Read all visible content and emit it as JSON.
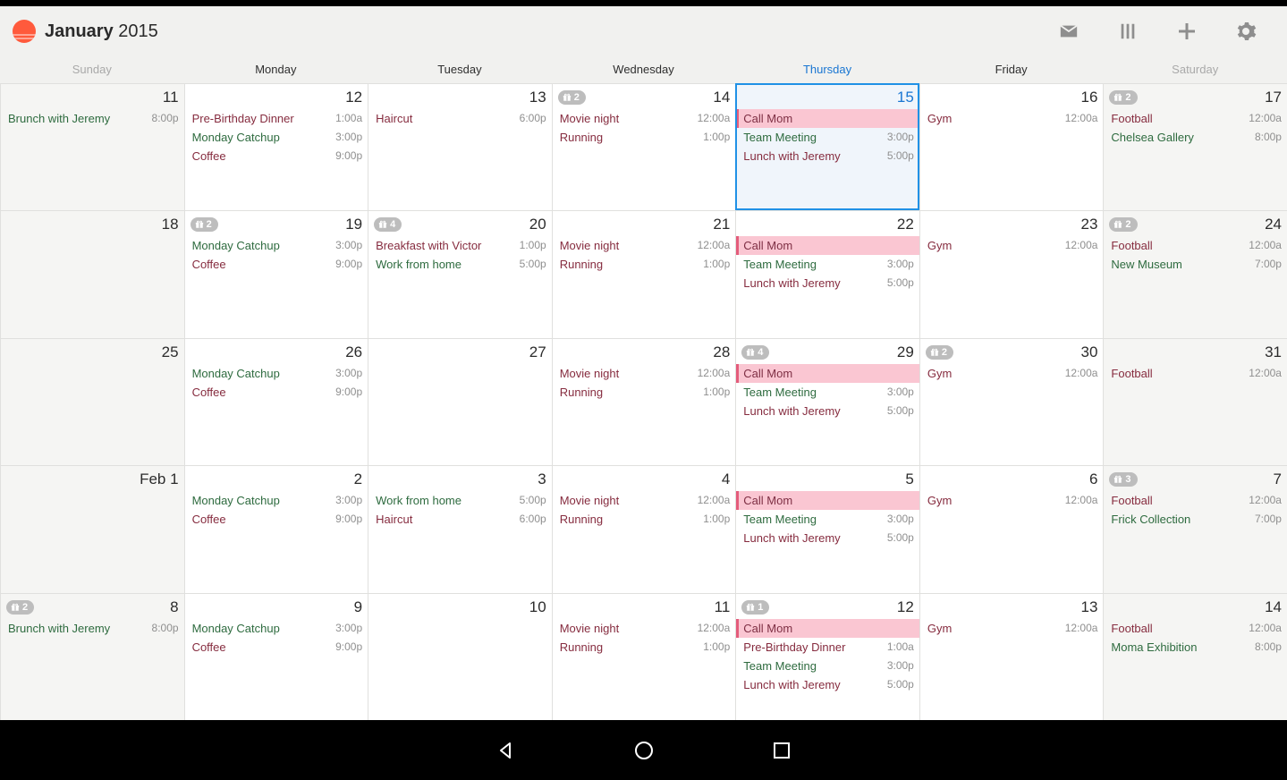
{
  "header": {
    "month": "January",
    "year": "2015"
  },
  "dayNames": [
    "Sunday",
    "Monday",
    "Tuesday",
    "Wednesday",
    "Thursday",
    "Friday",
    "Saturday"
  ],
  "todayIndex": 4,
  "weeks": [
    [
      {
        "day": "11",
        "weekend": true,
        "events": [
          {
            "title": "Brunch with Jeremy",
            "time": "8:00p",
            "color": "green"
          }
        ]
      },
      {
        "day": "12",
        "events": [
          {
            "title": "Pre-Birthday Dinner",
            "time": "1:00a",
            "color": "maroon"
          },
          {
            "title": "Monday Catchup",
            "time": "3:00p",
            "color": "green"
          },
          {
            "title": "Coffee",
            "time": "9:00p",
            "color": "maroon"
          }
        ]
      },
      {
        "day": "13",
        "events": [
          {
            "title": "Haircut",
            "time": "6:00p",
            "color": "maroon"
          }
        ]
      },
      {
        "day": "14",
        "badge": "2",
        "events": [
          {
            "title": "Movie night",
            "time": "12:00a",
            "color": "maroon"
          },
          {
            "title": "Running",
            "time": "1:00p",
            "color": "maroon"
          }
        ]
      },
      {
        "day": "15",
        "today": true,
        "events": [
          {
            "title": "Call Mom",
            "color": "pinkbar"
          },
          {
            "title": "Team Meeting",
            "time": "3:00p",
            "color": "green"
          },
          {
            "title": "Lunch with Jeremy",
            "time": "5:00p",
            "color": "maroon"
          }
        ]
      },
      {
        "day": "16",
        "events": [
          {
            "title": "Gym",
            "time": "12:00a",
            "color": "maroon"
          }
        ]
      },
      {
        "day": "17",
        "weekend": true,
        "badge": "2",
        "events": [
          {
            "title": "Football",
            "time": "12:00a",
            "color": "maroon"
          },
          {
            "title": "Chelsea Gallery",
            "time": "8:00p",
            "color": "green"
          }
        ]
      }
    ],
    [
      {
        "day": "18",
        "weekend": true,
        "events": []
      },
      {
        "day": "19",
        "badge": "2",
        "events": [
          {
            "title": "Monday Catchup",
            "time": "3:00p",
            "color": "green"
          },
          {
            "title": "Coffee",
            "time": "9:00p",
            "color": "maroon"
          }
        ]
      },
      {
        "day": "20",
        "badge": "4",
        "events": [
          {
            "title": "Breakfast with Victor",
            "time": "1:00p",
            "color": "maroon"
          },
          {
            "title": "Work from home",
            "time": "5:00p",
            "color": "green"
          }
        ]
      },
      {
        "day": "21",
        "events": [
          {
            "title": "Movie night",
            "time": "12:00a",
            "color": "maroon"
          },
          {
            "title": "Running",
            "time": "1:00p",
            "color": "maroon"
          }
        ]
      },
      {
        "day": "22",
        "events": [
          {
            "title": "Call Mom",
            "color": "pinkbar"
          },
          {
            "title": "Team Meeting",
            "time": "3:00p",
            "color": "green"
          },
          {
            "title": "Lunch with Jeremy",
            "time": "5:00p",
            "color": "maroon"
          }
        ]
      },
      {
        "day": "23",
        "events": [
          {
            "title": "Gym",
            "time": "12:00a",
            "color": "maroon"
          }
        ]
      },
      {
        "day": "24",
        "weekend": true,
        "badge": "2",
        "events": [
          {
            "title": "Football",
            "time": "12:00a",
            "color": "maroon"
          },
          {
            "title": "New Museum",
            "time": "7:00p",
            "color": "green"
          }
        ]
      }
    ],
    [
      {
        "day": "25",
        "weekend": true,
        "events": []
      },
      {
        "day": "26",
        "events": [
          {
            "title": "Monday Catchup",
            "time": "3:00p",
            "color": "green"
          },
          {
            "title": "Coffee",
            "time": "9:00p",
            "color": "maroon"
          }
        ]
      },
      {
        "day": "27",
        "events": []
      },
      {
        "day": "28",
        "events": [
          {
            "title": "Movie night",
            "time": "12:00a",
            "color": "maroon"
          },
          {
            "title": "Running",
            "time": "1:00p",
            "color": "maroon"
          }
        ]
      },
      {
        "day": "29",
        "badge": "4",
        "events": [
          {
            "title": "Call Mom",
            "color": "pinkbar"
          },
          {
            "title": "Team Meeting",
            "time": "3:00p",
            "color": "green"
          },
          {
            "title": "Lunch with Jeremy",
            "time": "5:00p",
            "color": "maroon"
          }
        ]
      },
      {
        "day": "30",
        "badge": "2",
        "events": [
          {
            "title": "Gym",
            "time": "12:00a",
            "color": "maroon"
          }
        ]
      },
      {
        "day": "31",
        "weekend": true,
        "events": [
          {
            "title": "Football",
            "time": "12:00a",
            "color": "maroon"
          }
        ]
      }
    ],
    [
      {
        "day": "Feb 1",
        "weekend": true,
        "events": []
      },
      {
        "day": "2",
        "events": [
          {
            "title": "Monday Catchup",
            "time": "3:00p",
            "color": "green"
          },
          {
            "title": "Coffee",
            "time": "9:00p",
            "color": "maroon"
          }
        ]
      },
      {
        "day": "3",
        "events": [
          {
            "title": "Work from home",
            "time": "5:00p",
            "color": "green"
          },
          {
            "title": "Haircut",
            "time": "6:00p",
            "color": "maroon"
          }
        ]
      },
      {
        "day": "4",
        "events": [
          {
            "title": "Movie night",
            "time": "12:00a",
            "color": "maroon"
          },
          {
            "title": "Running",
            "time": "1:00p",
            "color": "maroon"
          }
        ]
      },
      {
        "day": "5",
        "events": [
          {
            "title": "Call Mom",
            "color": "pinkbar"
          },
          {
            "title": "Team Meeting",
            "time": "3:00p",
            "color": "green"
          },
          {
            "title": "Lunch with Jeremy",
            "time": "5:00p",
            "color": "maroon"
          }
        ]
      },
      {
        "day": "6",
        "events": [
          {
            "title": "Gym",
            "time": "12:00a",
            "color": "maroon"
          }
        ]
      },
      {
        "day": "7",
        "weekend": true,
        "badge": "3",
        "events": [
          {
            "title": "Football",
            "time": "12:00a",
            "color": "maroon"
          },
          {
            "title": "Frick Collection",
            "time": "7:00p",
            "color": "green"
          }
        ]
      }
    ],
    [
      {
        "day": "8",
        "weekend": true,
        "badge": "2",
        "events": [
          {
            "title": "Brunch with Jeremy",
            "time": "8:00p",
            "color": "green"
          }
        ]
      },
      {
        "day": "9",
        "events": [
          {
            "title": "Monday Catchup",
            "time": "3:00p",
            "color": "green"
          },
          {
            "title": "Coffee",
            "time": "9:00p",
            "color": "maroon"
          }
        ]
      },
      {
        "day": "10",
        "events": []
      },
      {
        "day": "11",
        "events": [
          {
            "title": "Movie night",
            "time": "12:00a",
            "color": "maroon"
          },
          {
            "title": "Running",
            "time": "1:00p",
            "color": "maroon"
          }
        ]
      },
      {
        "day": "12",
        "badge": "1",
        "events": [
          {
            "title": "Call Mom",
            "color": "pinkbar"
          },
          {
            "title": "Pre-Birthday Dinner",
            "time": "1:00a",
            "color": "maroon"
          },
          {
            "title": "Team Meeting",
            "time": "3:00p",
            "color": "green"
          },
          {
            "title": "Lunch with Jeremy",
            "time": "5:00p",
            "color": "maroon"
          }
        ]
      },
      {
        "day": "13",
        "events": [
          {
            "title": "Gym",
            "time": "12:00a",
            "color": "maroon"
          }
        ]
      },
      {
        "day": "14",
        "weekend": true,
        "events": [
          {
            "title": "Football",
            "time": "12:00a",
            "color": "maroon"
          },
          {
            "title": "Moma Exhibition",
            "time": "8:00p",
            "color": "green"
          }
        ]
      }
    ]
  ]
}
